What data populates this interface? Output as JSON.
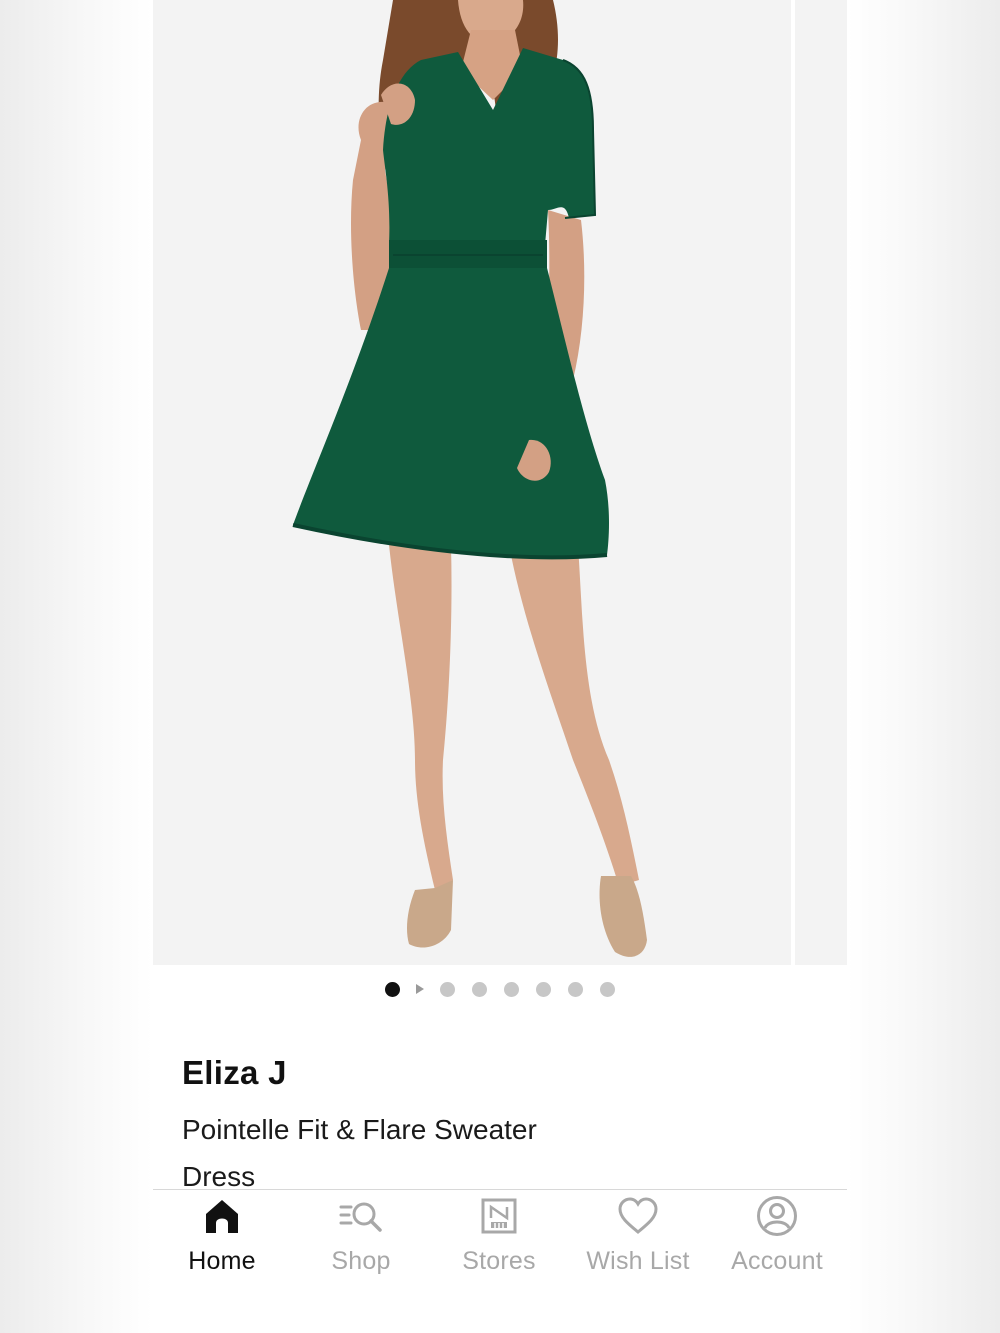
{
  "gallery": {
    "image_count": 7,
    "active_index": 0,
    "video_after_index": 0
  },
  "product": {
    "brand": "Eliza J",
    "name": "Pointelle Fit & Flare Sweater Dress",
    "dress_color": "#0f5a3d"
  },
  "tabbar": {
    "tabs": [
      {
        "label": "Home",
        "icon": "home-icon",
        "active": true
      },
      {
        "label": "Shop",
        "icon": "shop-search-icon",
        "active": false
      },
      {
        "label": "Stores",
        "icon": "stores-icon",
        "active": false
      },
      {
        "label": "Wish List",
        "icon": "heart-icon",
        "active": false
      },
      {
        "label": "Account",
        "icon": "account-icon",
        "active": false
      }
    ]
  },
  "colors": {
    "active": "#111111",
    "inactive": "#a8a8a8"
  }
}
